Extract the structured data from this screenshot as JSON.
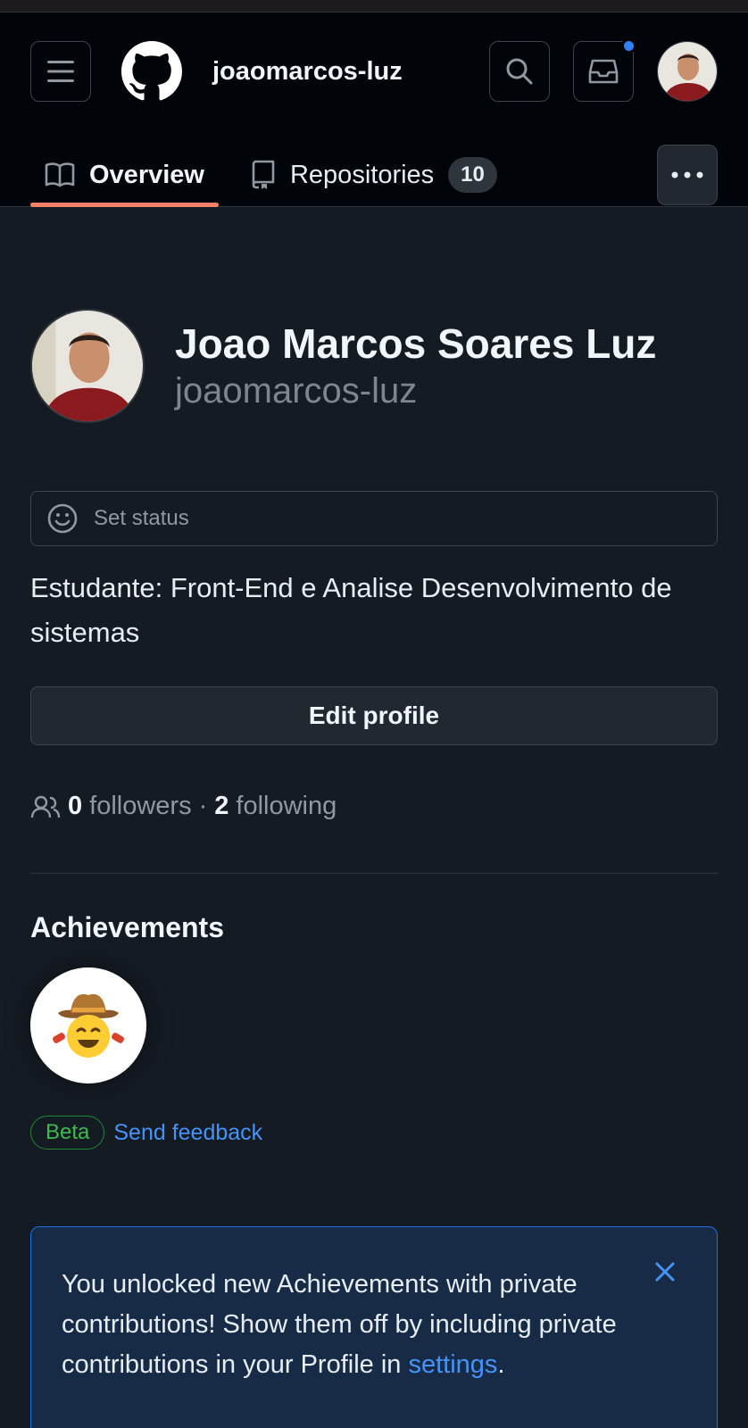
{
  "header": {
    "username": "joaomarcos-luz",
    "accent": "#f78166",
    "notification_dot_color": "#2f81f7"
  },
  "tabs": [
    {
      "label": "Overview",
      "icon": "book-icon",
      "active": true
    },
    {
      "label": "Repositories",
      "icon": "repo-icon",
      "count": "10"
    }
  ],
  "profile": {
    "full_name": "Joao Marcos Soares Luz",
    "login": "joaomarcos-luz",
    "status_label": "Set status",
    "bio": "Estudante: Front-End e Analise Desenvolvimento de sistemas",
    "edit_label": "Edit profile",
    "followers_count": "0",
    "followers_label": "followers",
    "separator": "·",
    "following_count": "2",
    "following_label": "following"
  },
  "achievements": {
    "title": "Achievements",
    "badge_icon": "cowboy-smile-icon",
    "beta_label": "Beta",
    "feedback_label": "Send feedback"
  },
  "notice": {
    "text_before": "You unlocked new Achievements with private contributions! Show them off by including private contributions in your Profile in ",
    "link_label": "settings",
    "text_after": "."
  }
}
